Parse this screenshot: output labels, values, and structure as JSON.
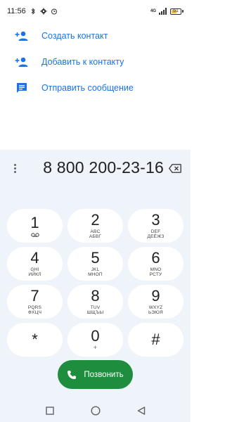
{
  "status_bar": {
    "time": "11:56",
    "battery_text": "51",
    "battery_level": 0.51,
    "signal_tag": "4G",
    "icons": [
      "bluetooth-icon",
      "settings-icon",
      "alarm-icon",
      "signal-icon",
      "battery-icon"
    ]
  },
  "actions": [
    {
      "label": "Создать контакт",
      "icon": "person-add-icon"
    },
    {
      "label": "Добавить к контакту",
      "icon": "person-add-icon"
    },
    {
      "label": "Отправить сообщение",
      "icon": "message-icon"
    }
  ],
  "dialer": {
    "number": "8 800 200-23-16",
    "keys": [
      {
        "digit": "1",
        "sub": ""
      },
      {
        "digit": "2",
        "sub": "ABC\nАБВГ"
      },
      {
        "digit": "3",
        "sub": "DEF\nДЕЁЖЗ"
      },
      {
        "digit": "4",
        "sub": "GHI\nИЙКЛ"
      },
      {
        "digit": "5",
        "sub": "JKL\nМНОП"
      },
      {
        "digit": "6",
        "sub": "MNO\nРСТУ"
      },
      {
        "digit": "7",
        "sub": "PQRS\nФХЦЧ"
      },
      {
        "digit": "8",
        "sub": "TUV\nШЩЪЫ"
      },
      {
        "digit": "9",
        "sub": "WXYZ\nЬЭЮЯ"
      },
      {
        "digit": "*",
        "sub": ""
      },
      {
        "digit": "0",
        "sub": "+"
      },
      {
        "digit": "#",
        "sub": ""
      }
    ],
    "call_label": "Позвонить"
  },
  "colors": {
    "accent": "#1a73e8",
    "call_green": "#1e8e3e",
    "panel_bg": "#eff3fa"
  }
}
